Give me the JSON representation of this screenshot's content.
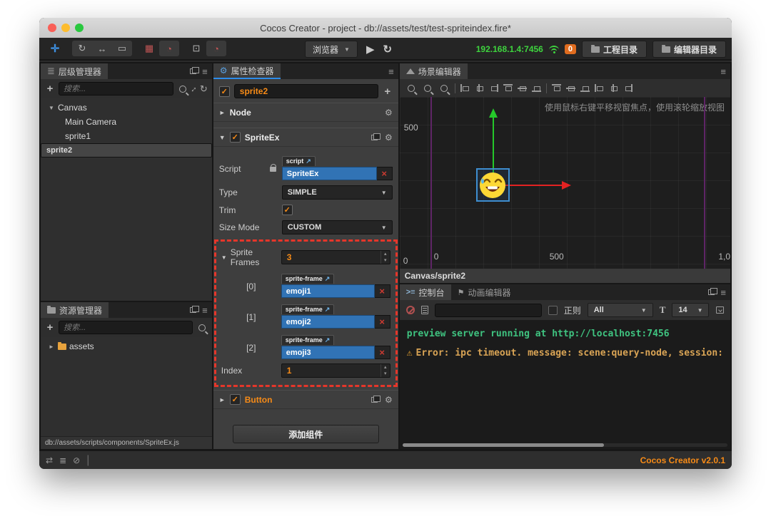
{
  "window": {
    "title": "Cocos Creator - project - db://assets/test/test-spriteindex.fire*",
    "version": "Cocos Creator v2.0.1"
  },
  "toolbar": {
    "preview_target": "浏览器",
    "ip": "192.168.1.4:7456",
    "badge": "0",
    "project_dir_label": "工程目录",
    "editor_dir_label": "编辑器目录"
  },
  "hierarchy": {
    "title": "层级管理器",
    "search_placeholder": "搜索...",
    "tree": [
      {
        "label": "Canvas"
      },
      {
        "label": "Main Camera"
      },
      {
        "label": "sprite1"
      },
      {
        "label": "sprite2"
      }
    ]
  },
  "assets": {
    "title": "资源管理器",
    "search_placeholder": "搜索...",
    "root": "assets",
    "selected_path": "db://assets/scripts/components/SpriteEx.js"
  },
  "inspector": {
    "title": "属性检查器",
    "node_name": "sprite2",
    "node_section": "Node",
    "sprite_section": "SpriteEx",
    "script_label": "Script",
    "script_tag": "script",
    "script_value": "SpriteEx",
    "type_label": "Type",
    "type_value": "SIMPLE",
    "trim_label": "Trim",
    "size_mode_label": "Size Mode",
    "size_mode_value": "CUSTOM",
    "sprite_frames_label": "Sprite Frames",
    "sprite_frames_count": "3",
    "frames": [
      {
        "index": "[0]",
        "tag": "sprite-frame",
        "value": "emoji1"
      },
      {
        "index": "[1]",
        "tag": "sprite-frame",
        "value": "emoji2"
      },
      {
        "index": "[2]",
        "tag": "sprite-frame",
        "value": "emoji3"
      }
    ],
    "index_label": "Index",
    "index_value": "1",
    "button_section": "Button",
    "add_component_label": "添加组件"
  },
  "scene": {
    "title": "场景编辑器",
    "hint": "使用鼠标右键平移视窗焦点，使用滚轮缩放视图",
    "ruler_left": "500",
    "coords": [
      "0",
      "0",
      "500",
      "1,0"
    ],
    "breadcrumb": "Canvas/sprite2"
  },
  "console": {
    "tab": "控制台",
    "anim_tab": "动画编辑器",
    "regex_label": "正则",
    "filter_value": "All",
    "font_label": "T",
    "font_size": "14",
    "logs": [
      {
        "type": "info",
        "text": "preview server running at http://localhost:7456"
      },
      {
        "type": "warn",
        "text": "Error: ipc timeout. message: scene:query-node, session:"
      }
    ]
  },
  "icons": {
    "menu": "≡",
    "refresh": "↻",
    "play": "▶",
    "plus": "+",
    "check": "✓",
    "close": "×",
    "caret_down": "▼",
    "caret_right": "►",
    "caret_up_small": "▴",
    "caret_down_small": "▾",
    "warning": "⚠",
    "gear": "⚙",
    "external": "↗",
    "expand": "↕",
    "move": "✛",
    "rotate": "↻",
    "scale": "↔",
    "rect_tool": "▭",
    "grid_tool": "▦",
    "box_tool": "⊡",
    "angle_tool": "◔",
    "sync": "⇄",
    "stack": "≣",
    "eye_off": "⊘",
    "console_prompt": ">≡",
    "anim_flag": "⚑"
  },
  "colors": {
    "accent_orange": "#f78b17",
    "asset_blue": "#3173b5",
    "net_green": "#3ed43e",
    "dashed_red": "#e5362a",
    "log_green": "#3fc380",
    "log_warn": "#d9a455",
    "active_tab_blue": "#2d8ceb"
  }
}
